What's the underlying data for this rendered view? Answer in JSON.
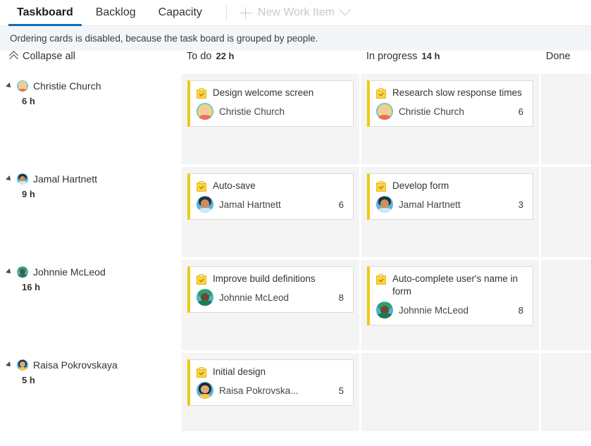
{
  "tabs": [
    {
      "label": "Taskboard",
      "active": true
    },
    {
      "label": "Backlog",
      "active": false
    },
    {
      "label": "Capacity",
      "active": false
    }
  ],
  "toolbar": {
    "new_work_item_label": "New Work Item",
    "plus_icon": "plus-icon",
    "chevron_icon": "chevron-down-icon",
    "disabled": true
  },
  "notice": {
    "message": "Ordering cards is disabled, because the task board is grouped by people."
  },
  "board": {
    "collapse_all_label": "Collapse all",
    "columns": [
      {
        "name": "To do",
        "hours": "22 h"
      },
      {
        "name": "In progress",
        "hours": "14 h"
      },
      {
        "name": "Done",
        "hours": ""
      }
    ],
    "rows": [
      {
        "person": "Christie Church",
        "hours": "6 h",
        "avatar": "christie",
        "todo": {
          "title": "Design welcome screen",
          "assignee": "Christie Church",
          "avatar": "christie",
          "hours": ""
        },
        "in_progress": {
          "title": "Research slow response times",
          "assignee": "Christie Church",
          "avatar": "christie",
          "hours": "6"
        },
        "done": null
      },
      {
        "person": "Jamal Hartnett",
        "hours": "9 h",
        "avatar": "jamal",
        "todo": {
          "title": "Auto-save",
          "assignee": "Jamal Hartnett",
          "avatar": "jamal",
          "hours": "6"
        },
        "in_progress": {
          "title": "Develop form",
          "assignee": "Jamal Hartnett",
          "avatar": "jamal",
          "hours": "3"
        },
        "done": null
      },
      {
        "person": "Johnnie McLeod",
        "hours": "16 h",
        "avatar": "johnnie",
        "todo": {
          "title": "Improve build definitions",
          "assignee": "Johnnie McLeod",
          "avatar": "johnnie",
          "hours": "8"
        },
        "in_progress": {
          "title": "Auto-complete user's name in form",
          "assignee": "Johnnie McLeod",
          "avatar": "johnnie",
          "hours": "8"
        },
        "done": null
      },
      {
        "person": "Raisa Pokrovskaya",
        "hours": "5 h",
        "avatar": "raisa",
        "todo": {
          "title": "Initial design",
          "assignee": "Raisa Pokrovska...",
          "avatar": "raisa",
          "hours": "5"
        },
        "in_progress": null,
        "done": null
      }
    ]
  },
  "colors": {
    "accent": "#106ebe",
    "card_stripe": "#f2c811",
    "notice_bg": "#f3f6f9",
    "cell_bg": "#f4f4f4"
  }
}
